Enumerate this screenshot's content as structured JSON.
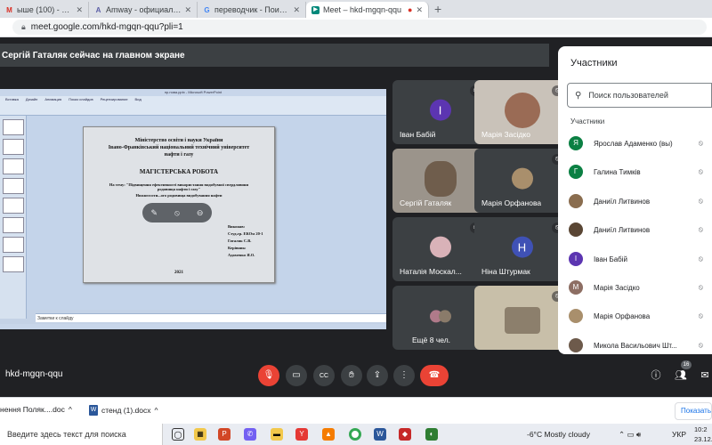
{
  "browser": {
    "tabs": [
      {
        "title": "ыше (100) - yarad1964@gm",
        "icon": "mail-icon",
        "color": "#d93025",
        "glyph": "M"
      },
      {
        "title": "Amway - официальный сайт и ин",
        "icon": "amway-icon",
        "color": "#5b5ea6",
        "glyph": "A"
      },
      {
        "title": "переводчик - Поиск в Google",
        "icon": "google-icon",
        "color": "#4285f4",
        "glyph": "G"
      },
      {
        "title": "Meet – hkd-mgqn-qqu",
        "icon": "meet-icon",
        "color": "#00897b",
        "glyph": "▶"
      }
    ],
    "new_tab": "+",
    "url": "meet.google.com/hkd-mgqn-qqu?pli=1"
  },
  "presenting_banner": "Сергій Гаталяк сейчас на главном экране",
  "slide": {
    "window_title": "пр.нова.pptx - Microsoft PowerPoint",
    "ribbon_tabs": [
      "Вставка",
      "Дизайн",
      "Анимация",
      "Показ слайдов",
      "Рецензирование",
      "Вид"
    ],
    "line1": "Міністерство освіти і науки України",
    "line2": "Івано-Франківський національний технічний університет",
    "line3": "нафти і газу",
    "heading": "МАГІСТЕРСЬКА РОБОТА",
    "topic1": "На тему: \"Підвищення ефективності використання видобувної свердловини родовища нафти і газу\"",
    "topic2": "Нижнєєсоти...ого родовища видобування нафти",
    "done_label": "Виконав:",
    "student_group": "Студ.гр. ЕКОм 20-1",
    "student_name": "Гаталяк С.В.",
    "supervisor_label": "Керівник:",
    "supervisor_name": "Адаменко Я.О.",
    "year": "2021",
    "notes": "Заметки к слайду"
  },
  "tiles": [
    {
      "name": "Іван Бабій",
      "initial": "І",
      "color": "#5c35b1"
    },
    {
      "name": "Марія Засідко",
      "initial": "",
      "color": "#c9a78f"
    },
    {
      "name": "Сергій Гаталяк",
      "initial": "",
      "color": "#7b6f63"
    },
    {
      "name": "Марія Орфанова",
      "initial": "",
      "color": "#a98f6c"
    },
    {
      "name": "Наталія Москал...",
      "initial": "",
      "color": "#b07a8a"
    },
    {
      "name": "Ніна Штурмак",
      "initial": "Н",
      "color": "#3f51b5"
    },
    {
      "name": "Ещё 8 чел.",
      "initial": "",
      "color": "#8a8a8a"
    },
    {
      "name": "",
      "initial": "",
      "color": "#7f7664"
    }
  ],
  "panel": {
    "title": "Участники",
    "search_placeholder": "Поиск пользователей",
    "section": "Участники",
    "participants": [
      {
        "name": "Ярослав Адаменко (вы)",
        "initial": "Я",
        "color": "#0b8043"
      },
      {
        "name": "Галина Тимків",
        "initial": "Г",
        "color": "#0b8043"
      },
      {
        "name": "Даниїл Литвинов",
        "initial": "",
        "color": "#8a6d4f"
      },
      {
        "name": "Даниїл Литвинов",
        "initial": "",
        "color": "#5a4634"
      },
      {
        "name": "Іван Бабій",
        "initial": "І",
        "color": "#5c35b1"
      },
      {
        "name": "Марія Засідко",
        "initial": "М",
        "color": "#8d6e63"
      },
      {
        "name": "Марія Орфанова",
        "initial": "",
        "color": "#a98f6c"
      },
      {
        "name": "Микола Васильович Шт...",
        "initial": "",
        "color": "#6d5a4b"
      }
    ]
  },
  "controls": {
    "meeting_code": "hkd-mgqn-qqu",
    "participants_count": "16"
  },
  "downloads": [
    {
      "name": "нення Поляк....doc"
    },
    {
      "name": "стенд (1).docx"
    }
  ],
  "show_all": "Показать",
  "taskbar": {
    "search_placeholder": "Введите здесь текст для поиска",
    "weather": "-6°C  Mostly cloudy",
    "lang": "УКР",
    "time": "10:2",
    "date": "23.12.2"
  }
}
